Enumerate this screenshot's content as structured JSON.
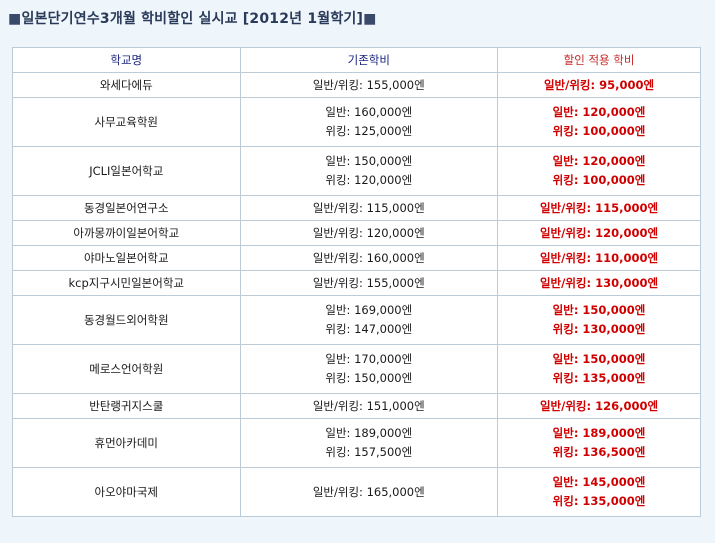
{
  "title": "일본단기연수3개월 학비할인 실시교 [2012년 1월학기]",
  "title_marker_left": "■",
  "title_marker_right": "■",
  "headers": {
    "school": "학교명",
    "base": "기존학비",
    "discount": "할인 적용 학비"
  },
  "rows": [
    {
      "school": "와세다에듀",
      "base": [
        "일반/위킹: 155,000엔"
      ],
      "discount": [
        "일반/위킹: 95,000엔"
      ]
    },
    {
      "school": "사무교육학원",
      "base": [
        "일반: 160,000엔",
        "위킹: 125,000엔"
      ],
      "discount": [
        "일반: 120,000엔",
        "위킹: 100,000엔"
      ]
    },
    {
      "school": "JCLI일본어학교",
      "base": [
        "일반: 150,000엔",
        "위킹: 120,000엔"
      ],
      "discount": [
        "일반: 120,000엔",
        "위킹: 100,000엔"
      ]
    },
    {
      "school": "동경일본어연구소",
      "base": [
        "일반/위킹: 115,000엔"
      ],
      "discount": [
        "일반/위킹: 115,000엔"
      ]
    },
    {
      "school": "아까몽까이일본어학교",
      "base": [
        "일반/위킹: 120,000엔"
      ],
      "discount": [
        "일반/위킹: 120,000엔"
      ]
    },
    {
      "school": "야마노일본어학교",
      "base": [
        "일반/위킹: 160,000엔"
      ],
      "discount": [
        "일반/위킹: 110,000엔"
      ]
    },
    {
      "school": "kcp지구시민일본어학교",
      "base": [
        "일반/위킹: 155,000엔"
      ],
      "discount": [
        "일반/위킹: 130,000엔"
      ]
    },
    {
      "school": "동경월드외어학원",
      "base": [
        "일반: 169,000엔",
        "위킹: 147,000엔"
      ],
      "discount": [
        "일반: 150,000엔",
        "위킹: 130,000엔"
      ]
    },
    {
      "school": "메로스언어학원",
      "base": [
        "일반: 170,000엔",
        "위킹: 150,000엔"
      ],
      "discount": [
        "일반: 150,000엔",
        "위킹: 135,000엔"
      ]
    },
    {
      "school": "반탄랭귀지스쿨",
      "base": [
        "일반/위킹: 151,000엔"
      ],
      "discount": [
        "일반/위킹: 126,000엔"
      ]
    },
    {
      "school": "휴먼아카데미",
      "base": [
        "일반: 189,000엔",
        "위킹: 157,500엔"
      ],
      "discount": [
        "일반: 189,000엔",
        "위킹: 136,500엔"
      ]
    },
    {
      "school": "아오야마국제",
      "base": [
        "일반/위킹: 165,000엔"
      ],
      "discount": [
        "일반: 145,000엔",
        "위킹: 135,000엔"
      ]
    }
  ],
  "colors": {
    "background": "#eef6fb",
    "header_text": "#1a237e",
    "discount_text": "#d00000",
    "border": "#bccbd8"
  }
}
